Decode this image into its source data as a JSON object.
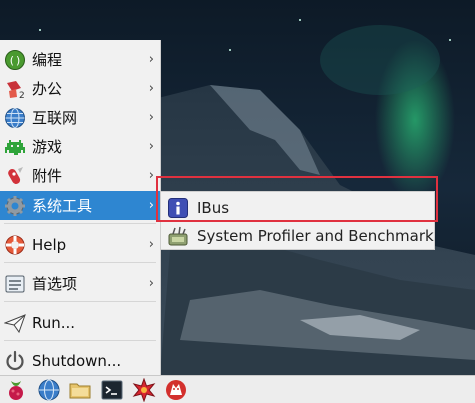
{
  "menu": {
    "items": [
      {
        "label": "编程",
        "icon": "programming-icon",
        "has_submenu": true
      },
      {
        "label": "办公",
        "icon": "office-icon",
        "has_submenu": true
      },
      {
        "label": "互联网",
        "icon": "internet-globe-icon",
        "has_submenu": true
      },
      {
        "label": "游戏",
        "icon": "games-invader-icon",
        "has_submenu": true
      },
      {
        "label": "附件",
        "icon": "accessories-knife-icon",
        "has_submenu": true
      },
      {
        "label": "系统工具",
        "icon": "system-tools-gear-icon",
        "has_submenu": true,
        "selected": true
      },
      {
        "label": "Help",
        "icon": "help-lifebuoy-icon",
        "has_submenu": true
      },
      {
        "label": "首选项",
        "icon": "preferences-icon",
        "has_submenu": true
      },
      {
        "label": "Run...",
        "icon": "run-paper-plane-icon",
        "has_submenu": false
      },
      {
        "label": "Shutdown...",
        "icon": "power-icon",
        "has_submenu": false
      }
    ],
    "arrow": "›"
  },
  "submenu": {
    "items": [
      {
        "label": "IBus",
        "icon": "ibus-info-icon"
      },
      {
        "label": "System Profiler and Benchmark",
        "icon": "system-profiler-icon"
      }
    ]
  },
  "taskbar": {
    "buttons": [
      {
        "name": "raspberry-menu-icon"
      },
      {
        "name": "web-browser-globe-icon"
      },
      {
        "name": "file-manager-folder-icon"
      },
      {
        "name": "terminal-icon"
      },
      {
        "name": "mathematica-star-icon"
      },
      {
        "name": "wolfram-icon"
      }
    ]
  },
  "colors": {
    "menu_bg": "#f1f1f1",
    "selection": "#2e86d1",
    "highlight_box": "#e0313f"
  }
}
